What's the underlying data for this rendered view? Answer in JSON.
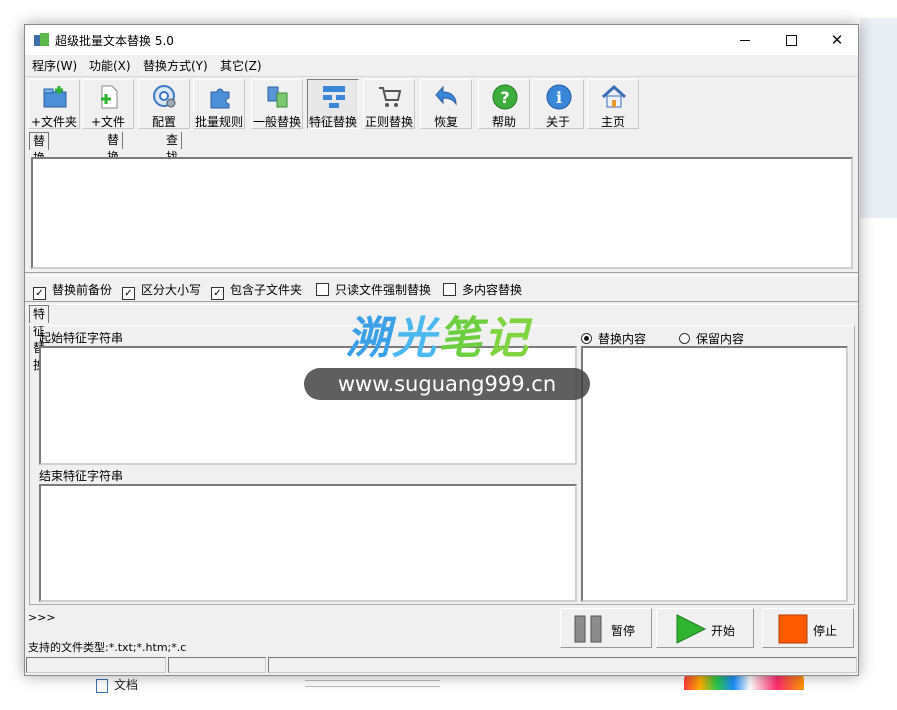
{
  "window": {
    "title": "超级批量文本替换 5.0"
  },
  "menu": [
    "程序(W)",
    "功能(X)",
    "替换方式(Y)",
    "其它(Z)"
  ],
  "toolbar": {
    "buttons": [
      {
        "label": "+文件夹",
        "icon": "add-folder-icon"
      },
      {
        "label": "+文件",
        "icon": "add-file-icon"
      },
      {
        "label": "配置",
        "icon": "settings-gear-icon"
      },
      {
        "label": "批量规则",
        "icon": "puzzle-icon"
      },
      {
        "label": "一般替换",
        "icon": "replace-docs-icon"
      },
      {
        "label": "特征替换",
        "icon": "structure-tree-icon"
      },
      {
        "label": "正则替换",
        "icon": "cart-icon"
      },
      {
        "label": "恢复",
        "icon": "restore-arrow-icon"
      },
      {
        "label": "帮助",
        "icon": "help-icon"
      },
      {
        "label": "关于",
        "icon": "info-icon"
      },
      {
        "label": "主页",
        "icon": "home-icon"
      }
    ],
    "active_index": 5
  },
  "top_tabs": [
    "替换源目标",
    "替换结果",
    "查找"
  ],
  "options": [
    {
      "label": "替换前备份",
      "checked": true
    },
    {
      "label": "区分大小写",
      "checked": true
    },
    {
      "label": "包含子文件夹",
      "checked": true
    },
    {
      "label": "只读文件强制替换",
      "checked": false
    },
    {
      "label": "多内容替换",
      "checked": false
    }
  ],
  "feature_tab": "特征替换",
  "feature": {
    "start_label": "起始特征字符串",
    "end_label": "结束特征字符串",
    "radio_replace": "替换内容",
    "radio_keep": "保留内容",
    "selected": "替换内容"
  },
  "log": {
    "prompt": ">>>",
    "supported_types": "支持的文件类型:*.txt;*.htm;*.c"
  },
  "actions": {
    "pause": "暂停",
    "start": "开始",
    "stop": "停止"
  },
  "watermark": {
    "logo": "溯光笔记",
    "url": "www.suguang999.cn"
  },
  "background": {
    "doc_label": "文档"
  },
  "colors": {
    "play_green": "#2fb52f",
    "stop_orange": "#ff5a00",
    "pause_gray": "#8c8c8c"
  }
}
